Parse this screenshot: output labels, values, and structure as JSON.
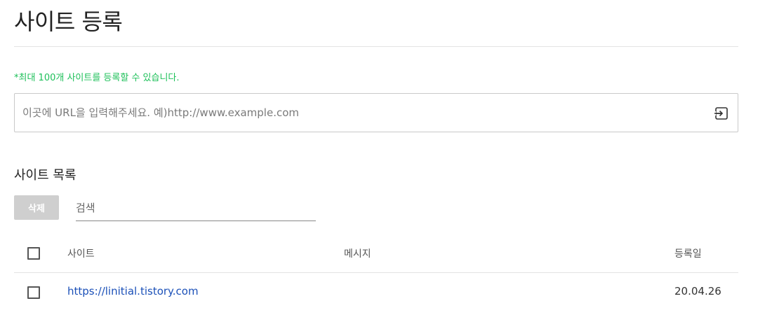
{
  "page": {
    "title": "사이트 등록",
    "limit_note": "*최대 100개 사이트를 등록할 수 있습니다."
  },
  "register": {
    "placeholder": "이곳에 URL을 입력해주세요. 예)http://www.example.com",
    "value": "",
    "submit_icon": "enter-icon"
  },
  "list": {
    "section_title": "사이트 목록",
    "delete_label": "삭제",
    "search_placeholder": "검색",
    "columns": {
      "site": "사이트",
      "message": "메시지",
      "date": "등록일"
    },
    "rows": [
      {
        "site": "https://linitial.tistory.com",
        "message": "",
        "date": "20.04.26",
        "checked": false
      }
    ]
  },
  "colors": {
    "note_green": "#1ec05a",
    "link_blue": "#1b50b8",
    "disabled_button": "#cfcfcf"
  }
}
